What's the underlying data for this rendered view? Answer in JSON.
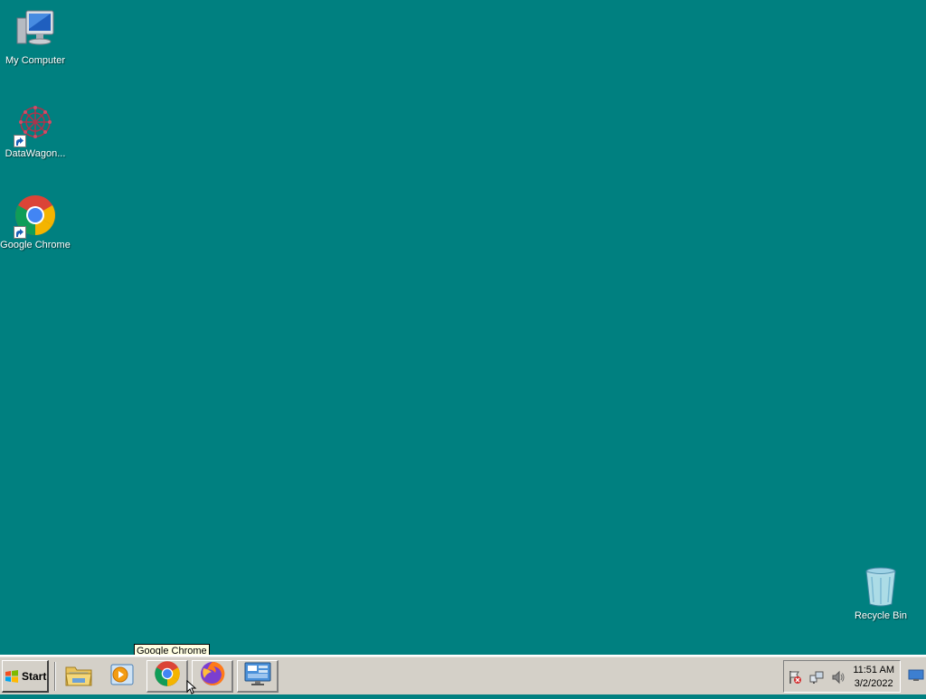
{
  "desktop": {
    "background": "#008080",
    "icons": [
      {
        "label": "My Computer",
        "icon": "computer-icon"
      },
      {
        "label": "DataWagon...",
        "icon": "datawagon-icon",
        "shortcut": true
      },
      {
        "label": "Google Chrome",
        "icon": "chrome-icon",
        "shortcut": true
      },
      {
        "label": "Recycle Bin",
        "icon": "recycle-bin-icon"
      }
    ]
  },
  "taskbar": {
    "start_label": "Start",
    "quick_launch": [
      {
        "name": "File Explorer",
        "icon": "folder-icon"
      },
      {
        "name": "Media Player",
        "icon": "media-player-icon"
      },
      {
        "name": "Google Chrome",
        "icon": "chrome-icon"
      },
      {
        "name": "Firefox",
        "icon": "firefox-icon"
      },
      {
        "name": "Server Manager",
        "icon": "server-manager-icon"
      }
    ],
    "tooltip": "Google Chrome",
    "clock": {
      "time": "11:51 AM",
      "date": "3/2/2022"
    },
    "tray_icons": [
      "action-center-flag-icon",
      "network-icon",
      "volume-icon"
    ]
  }
}
